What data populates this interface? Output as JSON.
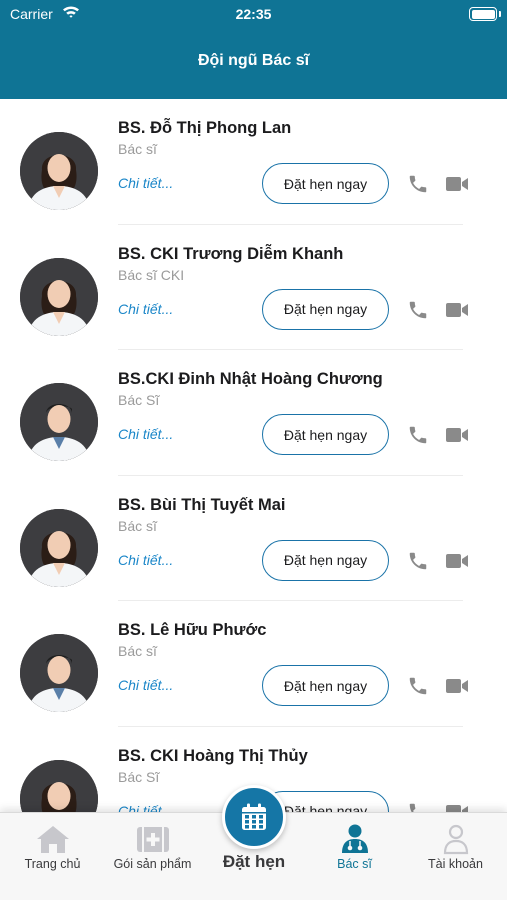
{
  "status_bar": {
    "carrier": "Carrier",
    "time": "22:35"
  },
  "header": {
    "title": "Đội ngũ Bác sĩ"
  },
  "doctors": [
    {
      "name": "BS. Đỗ Thị Phong Lan",
      "title": "Bác sĩ",
      "details": "Chi tiết...",
      "book": "Đặt hẹn ngay",
      "gender": "female"
    },
    {
      "name": "BS. CKI Trương Diễm Khanh",
      "title": "Bác sĩ CKI",
      "details": "Chi tiết...",
      "book": "Đặt hẹn ngay",
      "gender": "female"
    },
    {
      "name": "BS.CKI Đinh Nhật Hoàng Chương",
      "title": "Bác Sĩ",
      "details": "Chi tiết...",
      "book": "Đặt hẹn ngay",
      "gender": "male"
    },
    {
      "name": "BS. Bùi Thị Tuyết Mai",
      "title": "Bác sĩ",
      "details": "Chi tiết...",
      "book": "Đặt hẹn ngay",
      "gender": "female"
    },
    {
      "name": "BS. Lê Hữu Phước",
      "title": "Bác sĩ",
      "details": "Chi tiết...",
      "book": "Đặt hẹn ngay",
      "gender": "male"
    },
    {
      "name": "BS. CKI Hoàng Thị Thủy",
      "title": "Bác Sĩ",
      "details": "Chi tiết...",
      "book": "Đặt hẹn ngay",
      "gender": "female"
    }
  ],
  "tabbar": {
    "home": "Trang chủ",
    "packages": "Gói sản phẩm",
    "appointment": "Đặt hẹn",
    "doctors": "Bác sĩ",
    "account": "Tài khoản"
  },
  "colors": {
    "brand": "#0f7495",
    "link": "#1a86c8",
    "active_tab": "#0f7495"
  },
  "icons": {
    "status": [
      "wifi-icon",
      "battery-icon"
    ],
    "row": [
      "phone-icon",
      "video-camera-icon"
    ],
    "tabs": [
      "home-icon",
      "medical-kit-icon",
      "calendar-icon",
      "doctor-icon",
      "user-icon"
    ]
  }
}
